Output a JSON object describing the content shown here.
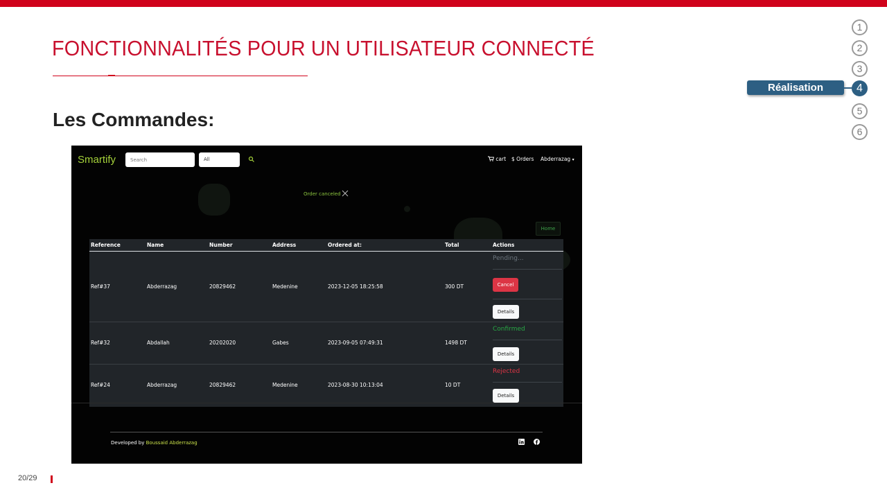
{
  "slide": {
    "title": "FONCTIONNALITÉS POUR UN UTILISATEUR CONNECTÉ",
    "subtitle": "Les Commandes:",
    "page_number": "20/29",
    "accent_color": "#d0021b"
  },
  "progress_nav": {
    "steps": [
      "1",
      "2",
      "3",
      "4",
      "5",
      "6"
    ],
    "active_step": "4",
    "active_label": "Réalisation",
    "active_color": "#2d5f83"
  },
  "app": {
    "brand": "Smartify",
    "search_placeholder": "Search",
    "category_select": "All",
    "nav": {
      "cart": "cart",
      "orders": "Orders",
      "user": "Abderrazag"
    },
    "alert": "Order canceled",
    "home_button": "Home",
    "table": {
      "headers": [
        "Reference",
        "Name",
        "Number",
        "Address",
        "Ordered at:",
        "Total",
        "Actions"
      ],
      "rows": [
        {
          "reference": "Ref#37",
          "name": "Abderrazag",
          "number": "20829462",
          "address": "Medenine",
          "ordered_at": "2023-12-05 18:25:58",
          "total": "300 DT",
          "status": "Pending...",
          "cancel": "Cancel",
          "details": "Details"
        },
        {
          "reference": "Ref#32",
          "name": "Abdallah",
          "number": "20202020",
          "address": "Gabes",
          "ordered_at": "2023-09-05 07:49:31",
          "total": "1498 DT",
          "status": "Confirmed",
          "details": "Details"
        },
        {
          "reference": "Ref#24",
          "name": "Abderrazag",
          "number": "20829462",
          "address": "Medenine",
          "ordered_at": "2023-08-30 10:13:04",
          "total": "10 DT",
          "status": "Rejected",
          "details": "Details"
        }
      ]
    },
    "footer": {
      "prefix": "Developed by",
      "author": "Boussaid Abderrazag"
    },
    "colors": {
      "brand": "#a4d13a",
      "pending": "#6c757d",
      "confirmed": "#28a745",
      "rejected": "#dc3545",
      "cancel": "#dc3545"
    }
  }
}
